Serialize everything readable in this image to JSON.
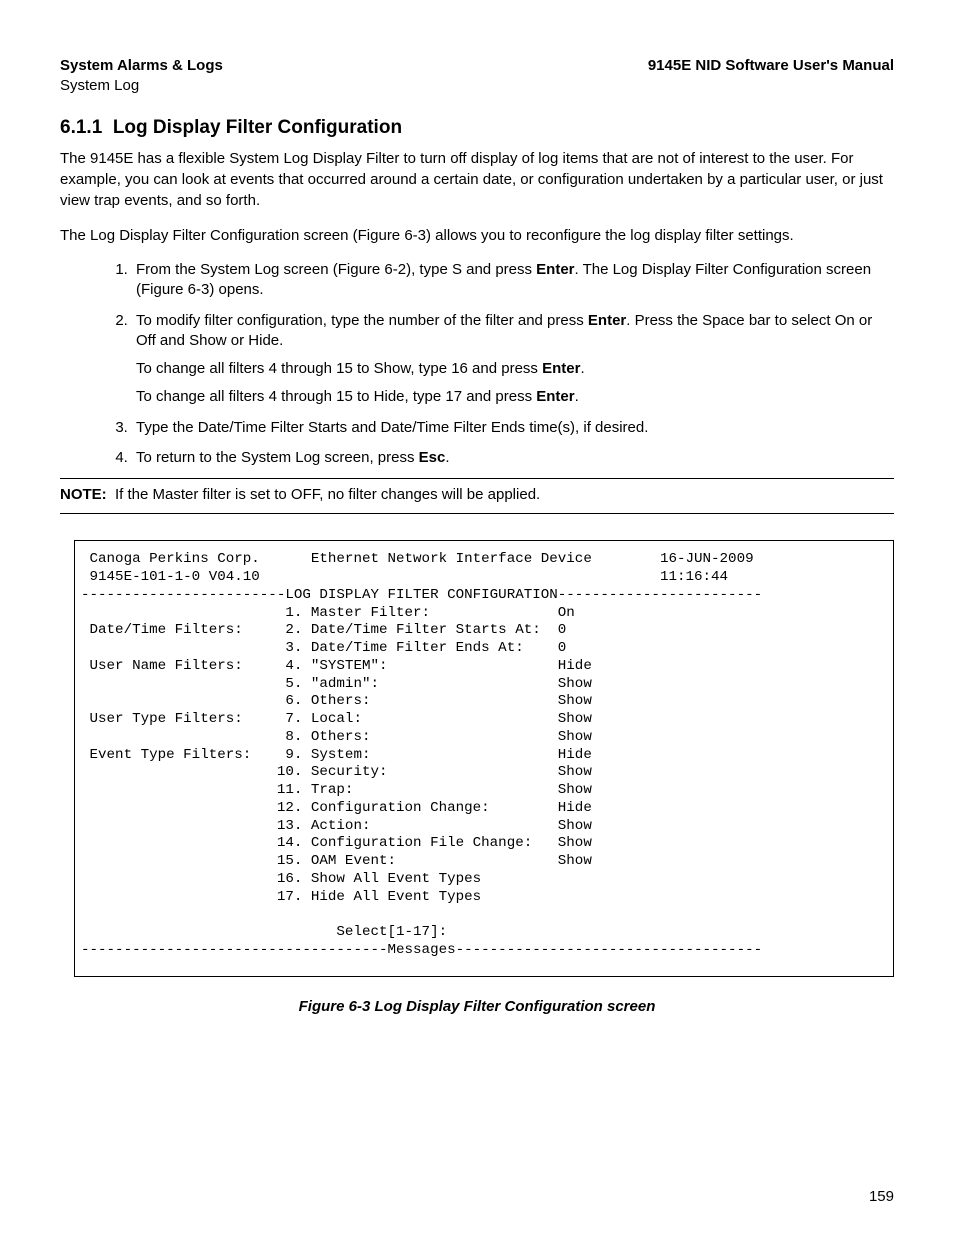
{
  "header": {
    "left_bold": "System Alarms & Logs",
    "right_bold": "9145E NID Software User's Manual",
    "left_sub": "System Log"
  },
  "section": {
    "number": "6.1.1",
    "title": "Log Display Filter Configuration"
  },
  "para1": "The 9145E has a flexible System Log Display Filter to turn off display of log items that are not of interest to the user. For example, you can look at events that occurred around a certain date, or configuration undertaken by a particular user, or just view trap events, and so forth.",
  "para2": "The Log Display Filter Configuration screen (Figure 6-3) allows you to reconfigure the log display filter settings.",
  "steps": {
    "s1a": "From the System Log screen (Figure 6-2), type S and press ",
    "s1b": ". The Log Display Filter Configuration screen (Figure 6-3) opens.",
    "s2a": "To modify filter configuration, type the number of the filter and press ",
    "s2b": ". Press the Space bar to select On or Off and Show or Hide.",
    "s2p1a": "To change all filters 4 through 15 to Show, type 16 and press ",
    "s2p1b": ".",
    "s2p2a": "To change all filters 4 through 15 to Hide, type 17 and press ",
    "s2p2b": ".",
    "s3": "Type the Date/Time Filter Starts and Date/Time Filter Ends time(s), if desired.",
    "s4a": "To return to the System Log screen, press ",
    "s4b": "."
  },
  "keys": {
    "enter": "Enter",
    "esc": "Esc"
  },
  "note": {
    "label": "NOTE:",
    "text": "If the Master filter is set to OFF, no filter changes will be applied."
  },
  "terminal": {
    "corp": "Canoga Perkins Corp.",
    "device": "Ethernet Network Interface Device",
    "date": "16-JUN-2009",
    "model": "9145E-101-1-0 V04.10",
    "time": "11:16:44",
    "title": "LOG DISPLAY FILTER CONFIGURATION",
    "groups": {
      "dt": "Date/Time Filters:",
      "un": "User Name Filters:",
      "ut": "User Type Filters:",
      "et": "Event Type Filters:"
    },
    "rows": [
      {
        "n": " 1",
        "label": "Master Filter:",
        "val": "On"
      },
      {
        "n": " 2",
        "label": "Date/Time Filter Starts At:",
        "val": "0"
      },
      {
        "n": " 3",
        "label": "Date/Time Filter Ends At:",
        "val": "0"
      },
      {
        "n": " 4",
        "label": "\"SYSTEM\":",
        "val": "Hide"
      },
      {
        "n": " 5",
        "label": "\"admin\":",
        "val": "Show"
      },
      {
        "n": " 6",
        "label": "Others:",
        "val": "Show"
      },
      {
        "n": " 7",
        "label": "Local:",
        "val": "Show"
      },
      {
        "n": " 8",
        "label": "Others:",
        "val": "Show"
      },
      {
        "n": " 9",
        "label": "System:",
        "val": "Hide"
      },
      {
        "n": "10",
        "label": "Security:",
        "val": "Show"
      },
      {
        "n": "11",
        "label": "Trap:",
        "val": "Show"
      },
      {
        "n": "12",
        "label": "Configuration Change:",
        "val": "Hide"
      },
      {
        "n": "13",
        "label": "Action:",
        "val": "Show"
      },
      {
        "n": "14",
        "label": "Configuration File Change:",
        "val": "Show"
      },
      {
        "n": "15",
        "label": "OAM Event:",
        "val": "Show"
      },
      {
        "n": "16",
        "label": "Show All Event Types",
        "val": ""
      },
      {
        "n": "17",
        "label": "Hide All Event Types",
        "val": ""
      }
    ],
    "select": "Select[1-17]:",
    "messages": "Messages"
  },
  "figure_caption": "Figure 6-3  Log Display Filter Configuration screen",
  "page_number": "159"
}
